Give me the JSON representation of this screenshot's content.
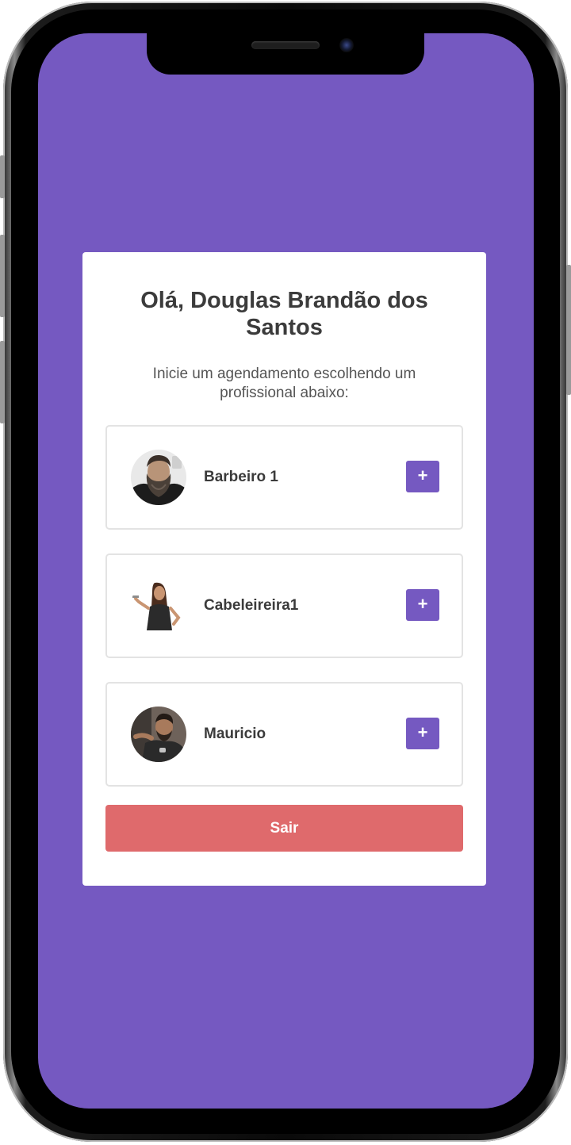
{
  "greeting": "Olá, Douglas Brandão dos Santos",
  "subtitle": "Inicie um agendamento escolhendo um profissional abaixo:",
  "professionals": [
    {
      "name": "Barbeiro 1",
      "add_label": "+"
    },
    {
      "name": "Cabeleireira1",
      "add_label": "+"
    },
    {
      "name": "Mauricio",
      "add_label": "+"
    }
  ],
  "logout_label": "Sair",
  "colors": {
    "background": "#7559c1",
    "accent": "#7559c1",
    "logout": "#df6a6c",
    "card": "#ffffff"
  },
  "icons": [
    "plus-icon"
  ]
}
